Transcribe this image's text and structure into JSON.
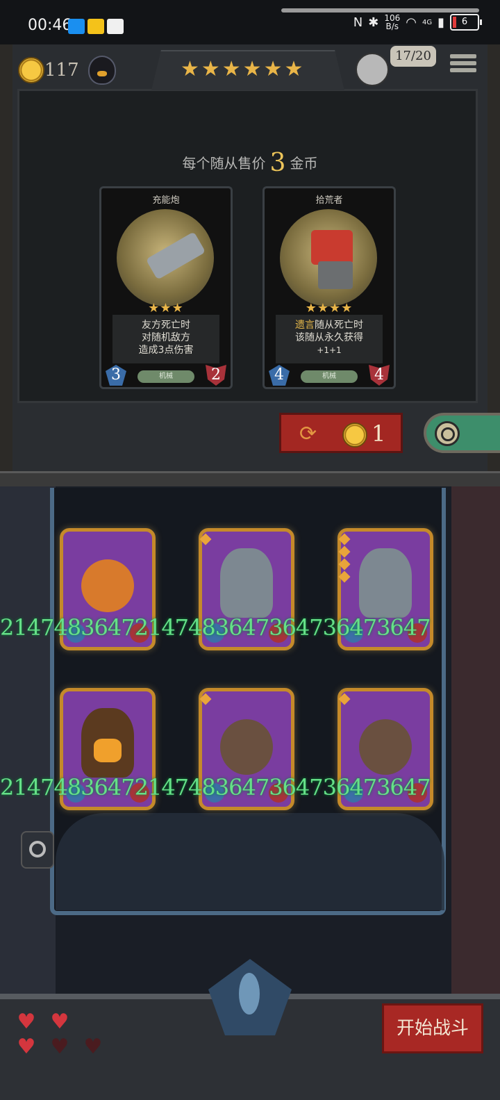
{
  "status_bar": {
    "time": "00:46",
    "net_speed_value": "106",
    "net_speed_unit": "B/s",
    "signal_label": "4G",
    "battery": "6",
    "app_icons": [
      "app-icon-blue",
      "unipay-icon",
      "byd-icon"
    ]
  },
  "hud": {
    "coins": "117",
    "stars": "★★★★★★",
    "board_count": "17/20"
  },
  "shop": {
    "caption_before": "每个随从售价",
    "caption_price": "3",
    "caption_after": "金币",
    "cards": [
      {
        "name": "充能炮",
        "stars": "★★★",
        "desc_lines": [
          "友方死亡时",
          "对随机敌方",
          "造成3点伤害"
        ],
        "tag": "机械",
        "attack": "3",
        "health": "2"
      },
      {
        "name": "拾荒者",
        "stars": "★★★★",
        "desc_keyword": "遗言",
        "desc_line1_rest": "随从死亡时",
        "desc_line2": "该随从永久获得",
        "desc_line3": "+1+1",
        "tag": "机械",
        "attack": "4",
        "health": "4"
      }
    ],
    "reroll_cost": "1"
  },
  "board": {
    "overflow_text_row1": "21474836472147483647364736473647",
    "overflow_text_row2": "21474836472147483647364736473647",
    "minions": [
      {
        "kind": "pumpkin",
        "pips": 0
      },
      {
        "kind": "demon",
        "pips": 1
      },
      {
        "kind": "demon",
        "pips": 4
      },
      {
        "kind": "tree",
        "pips": 0
      },
      {
        "kind": "mole",
        "pips": 1
      },
      {
        "kind": "mole",
        "pips": 1
      }
    ]
  },
  "lives": {
    "full": 3,
    "total": 5
  },
  "start_button": "开始战斗",
  "colors": {
    "gold": "#e9b548",
    "reroll_red": "#a32722",
    "overflow_green": "#66e088",
    "card_frame": "#c58a2a"
  }
}
